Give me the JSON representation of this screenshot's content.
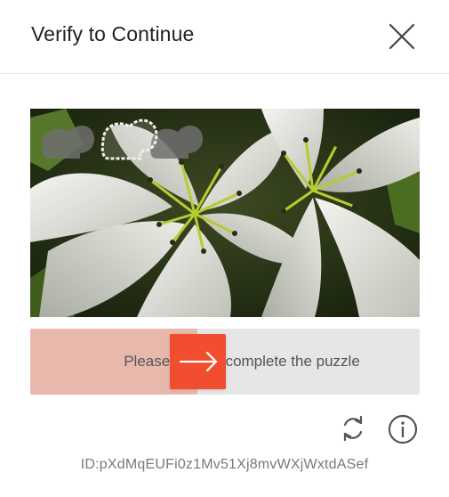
{
  "dialog": {
    "title": "Verify to Continue"
  },
  "slider": {
    "instruction": "Please drag to complete the puzzle",
    "progress": 0.43
  },
  "footer": {
    "id_text": "ID:pXdMqEUFi0z1Mv51Xj8mvWXjWxtdASef"
  },
  "icons": {
    "close": "close-icon",
    "refresh": "refresh-icon",
    "info": "info-icon",
    "slider_arrow": "arrow-right-icon"
  },
  "colors": {
    "accent": "#f04e2e",
    "slider_fill": "#e9b8ad",
    "track": "#e6e6e6"
  }
}
